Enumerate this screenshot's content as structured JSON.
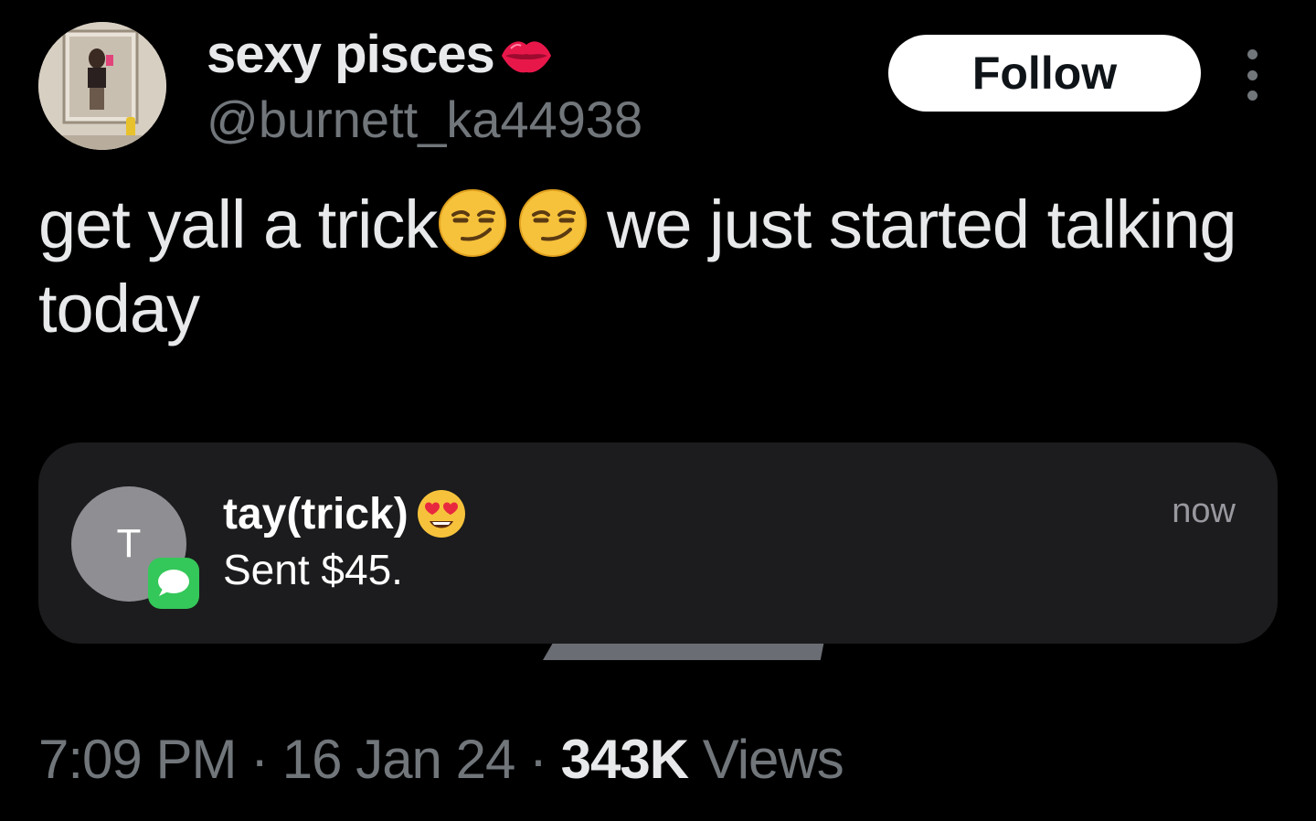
{
  "tweet": {
    "author": {
      "display_name": "sexy pisces",
      "name_emoji": "lips-icon",
      "handle": "@burnett_ka44938"
    },
    "follow_label": "Follow",
    "text_part1": "get yall a trick",
    "text_emoji": "smirking-face-emoji",
    "text_part2": " we just started talking today",
    "meta": {
      "time": "7:09 PM",
      "separator": " · ",
      "date": "16 Jan 24",
      "views_count": "343K",
      "views_label": "Views"
    }
  },
  "notification": {
    "avatar_initial": "T",
    "app_icon": "messages-icon",
    "sender": "tay(trick)",
    "sender_emoji": "heart-eyes-emoji",
    "body": "Sent $45.",
    "time": "now"
  },
  "colors": {
    "background": "#000000",
    "primary_text": "#e7e9ea",
    "secondary_text": "#71767b",
    "notification_bg": "#1c1c1e",
    "messages_green": "#34c759"
  }
}
